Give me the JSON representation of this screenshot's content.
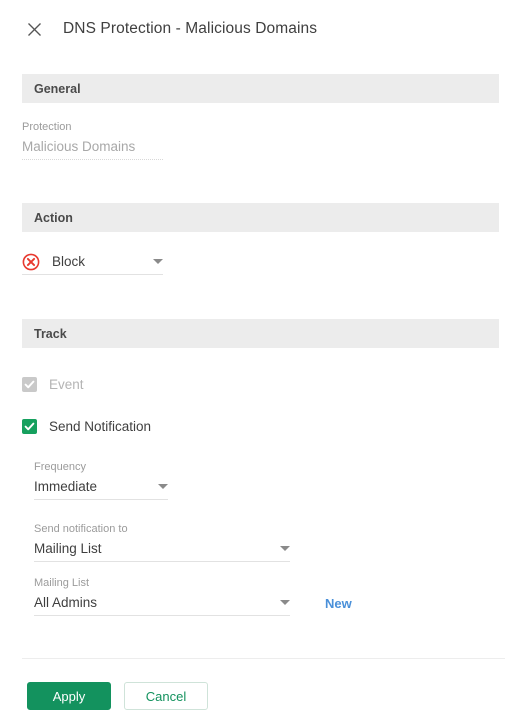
{
  "header": {
    "close_icon": "close-icon",
    "title": "DNS Protection - Malicious Domains"
  },
  "sections": {
    "general": {
      "bar_label": "General",
      "protection": {
        "label": "Protection",
        "value": "Malicious Domains",
        "disabled": true
      }
    },
    "action": {
      "bar_label": "Action",
      "icon": "block-circle-x-icon",
      "icon_color": "#e8392f",
      "value": "Block",
      "caret_icon": "chevron-down-icon"
    },
    "track": {
      "bar_label": "Track",
      "event": {
        "label": "Event",
        "checked": true,
        "disabled": true
      },
      "send_notification": {
        "label": "Send Notification",
        "checked": true
      },
      "frequency": {
        "label": "Frequency",
        "value": "Immediate"
      },
      "send_notification_to": {
        "label": "Send notification to",
        "value": "Mailing List"
      },
      "mailing_list": {
        "label": "Mailing List",
        "value": "All Admins"
      },
      "new_link": "New"
    }
  },
  "footer": {
    "apply_label": "Apply",
    "cancel_label": "Cancel"
  },
  "colors": {
    "accent_green": "#13925e",
    "checkbox_green": "#16a05e",
    "link_blue": "#4a90d9",
    "deny_red": "#e8392f",
    "section_bar_bg": "#ececec"
  }
}
